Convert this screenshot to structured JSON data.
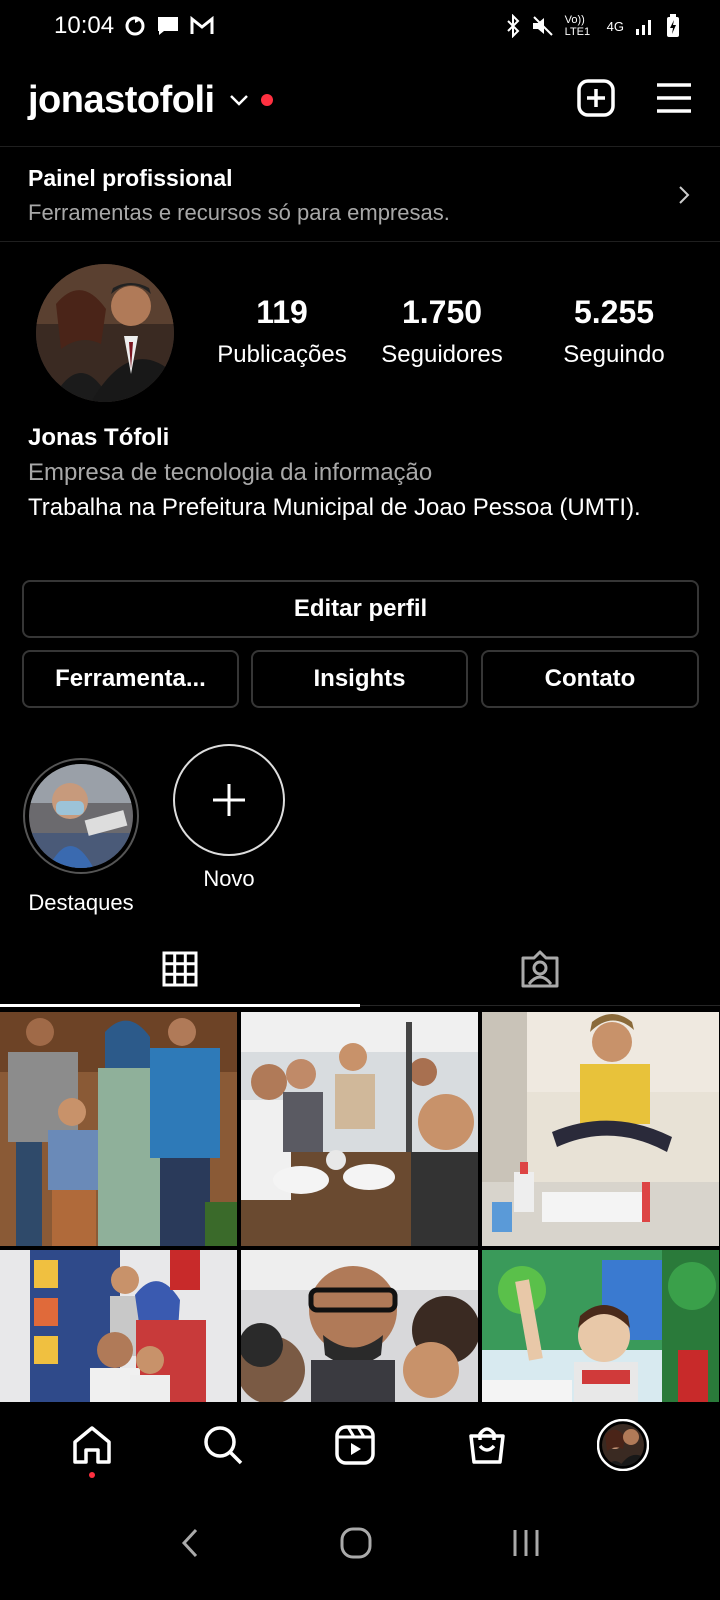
{
  "status_bar": {
    "time": "10:04",
    "volte": "Vo)) LTE1",
    "network": "4G"
  },
  "header": {
    "username": "jonastofoli"
  },
  "panel": {
    "title": "Painel profissional",
    "subtitle": "Ferramentas e recursos só para empresas."
  },
  "stats": [
    {
      "value": "119",
      "label": "Publicações"
    },
    {
      "value": "1.750",
      "label": "Seguidores"
    },
    {
      "value": "5.255",
      "label": "Seguindo"
    }
  ],
  "bio": {
    "name": "Jonas Tófoli",
    "category": "Empresa de tecnologia da informação",
    "text": "Trabalha na Prefeitura Municipal de Joao Pessoa (UMTI)."
  },
  "buttons": {
    "edit_profile": "Editar perfil",
    "tools": "Ferramenta...",
    "insights": "Insights",
    "contact": "Contato"
  },
  "highlights": [
    {
      "label": "Destaques"
    },
    {
      "label": "Novo"
    }
  ],
  "tabs": [
    "grid-icon",
    "tagged-icon"
  ],
  "bottom_nav": [
    "home-icon",
    "search-icon",
    "reels-icon",
    "shop-icon",
    "profile-avatar"
  ],
  "colors": {
    "background": "#000000",
    "notification_dot": "#ff3040",
    "secondary_text": "#a8a8a8",
    "button_border": "#363636"
  }
}
